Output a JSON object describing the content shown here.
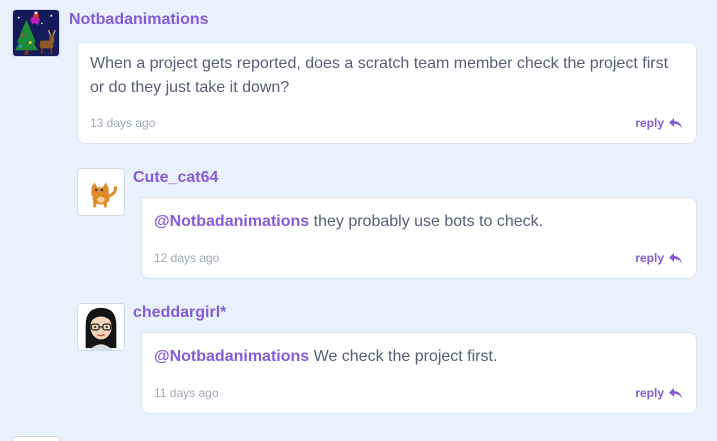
{
  "comments": [
    {
      "username": "Notbadanimations",
      "avatar_icon": "christmas-tree-reindeer-icon",
      "mention": "",
      "text": "When a project gets reported, does a scratch team member check the project first or do they just take it down?",
      "time": "13 days ago",
      "reply_label": "reply"
    },
    {
      "username": "Cute_cat64",
      "avatar_icon": "orange-cat-icon",
      "mention": "@Notbadanimations",
      "text": "they probably use bots to check.",
      "time": "12 days ago",
      "reply_label": "reply"
    },
    {
      "username": "cheddargirl*",
      "avatar_icon": "girl-with-glasses-icon",
      "mention": "@Notbadanimations",
      "text": "We check the project first.",
      "time": "11 days ago",
      "reply_label": "reply"
    }
  ],
  "colors": {
    "accent": "#855cd6",
    "background": "#e9f1fc",
    "text": "#575e75",
    "muted": "#a0a8b6"
  }
}
